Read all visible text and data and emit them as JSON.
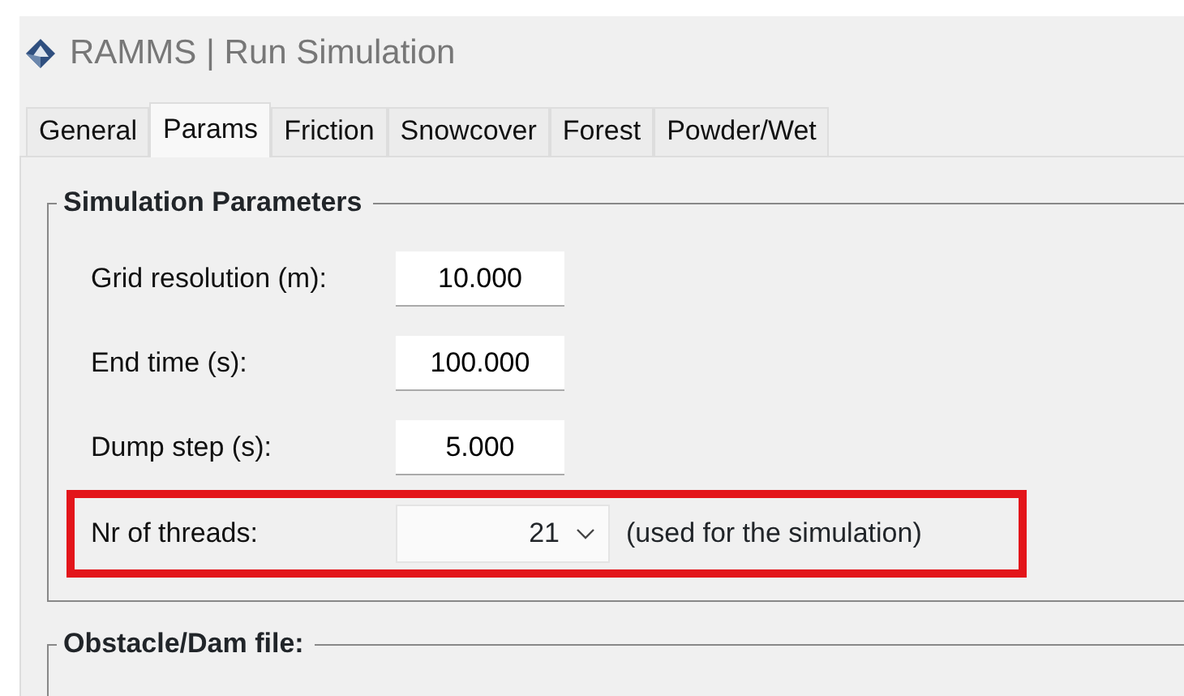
{
  "window": {
    "title": "RAMMS | Run Simulation"
  },
  "tabs": [
    {
      "label": "General",
      "selected": false
    },
    {
      "label": "Params",
      "selected": true
    },
    {
      "label": "Friction",
      "selected": false
    },
    {
      "label": "Snowcover",
      "selected": false
    },
    {
      "label": "Forest",
      "selected": false
    },
    {
      "label": "Powder/Wet",
      "selected": false
    }
  ],
  "groups": [
    {
      "title": "Simulation Parameters",
      "rows": [
        {
          "kind": "text",
          "label": "Grid resolution (m):",
          "value": "10.000",
          "highlighted": false
        },
        {
          "kind": "text",
          "label": "End time (s):",
          "value": "100.000",
          "highlighted": false
        },
        {
          "kind": "text",
          "label": "Dump step (s):",
          "value": "5.000",
          "highlighted": false
        },
        {
          "kind": "combo",
          "label": "Nr of threads:",
          "value": "21",
          "note": "(used for the simulation)",
          "highlighted": true
        }
      ]
    },
    {
      "title": "Obstacle/Dam file:"
    }
  ]
}
